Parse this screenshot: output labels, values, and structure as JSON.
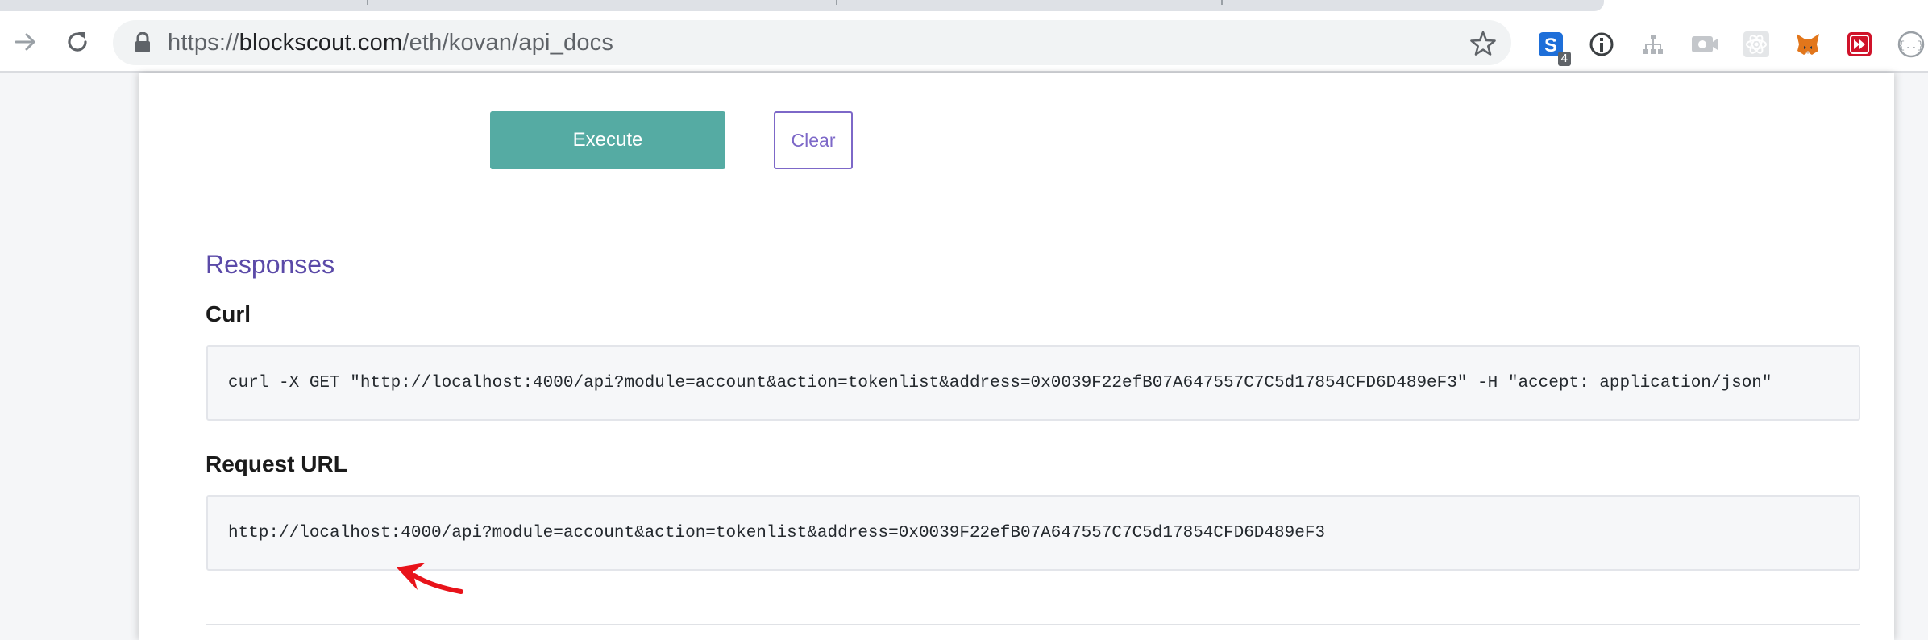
{
  "browser": {
    "url_scheme": "https://",
    "url_domain": "blockscout.com",
    "url_path": "/eth/kovan/api_docs",
    "extensions": [
      {
        "name": "s-extension-icon",
        "badge": "4"
      },
      {
        "name": "info-circle-icon"
      },
      {
        "name": "sitemap-icon"
      },
      {
        "name": "camera-disabled-icon"
      },
      {
        "name": "react-devtools-icon"
      },
      {
        "name": "metamask-fox-icon"
      },
      {
        "name": "fast-forward-icon"
      },
      {
        "name": "json-braces-icon"
      }
    ]
  },
  "actions": {
    "execute_label": "Execute",
    "clear_label": "Clear"
  },
  "responses": {
    "title": "Responses",
    "curl_label": "Curl",
    "curl_command": "curl -X GET \"http://localhost:4000/api?module=account&action=tokenlist&address=0x0039F22efB07A647557C7C5d17854CFD6D489eF3\" -H \"accept: application/json\"",
    "request_url_label": "Request URL",
    "request_url": "http://localhost:4000/api?module=account&action=tokenlist&address=0x0039F22efB07A647557C7C5d17854CFD6D489eF3"
  },
  "colors": {
    "execute_bg": "#55aba3",
    "clear_border": "#7d68c8",
    "responses_title": "#5b4aa8",
    "annotation": "#e8131a"
  }
}
